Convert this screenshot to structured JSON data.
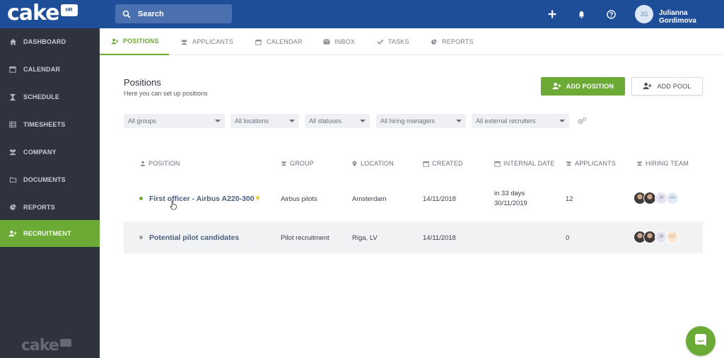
{
  "brand": {
    "logo_text": "cake",
    "logo_badge": "HR"
  },
  "colors": {
    "topbar": "#1f4e99",
    "sidebar": "#2e333d",
    "accent_green": "#6aaa35",
    "link_blue": "#4b5f80"
  },
  "search": {
    "placeholder": "Search"
  },
  "user": {
    "initials": "JG",
    "name": "Julianna Gordimova"
  },
  "topbar_icons": [
    "plus-icon",
    "bell-icon",
    "help-icon"
  ],
  "sidebar": {
    "items": [
      {
        "label": "DASHBOARD",
        "icon": "home-icon"
      },
      {
        "label": "CALENDAR",
        "icon": "calendar-icon"
      },
      {
        "label": "SCHEDULE",
        "icon": "hourglass-icon"
      },
      {
        "label": "TIMESHEETS",
        "icon": "table-icon"
      },
      {
        "label": "COMPANY",
        "icon": "users-icon"
      },
      {
        "label": "DOCUMENTS",
        "icon": "folder-icon"
      },
      {
        "label": "REPORTS",
        "icon": "pie-chart-icon"
      },
      {
        "label": "RECRUITMENT",
        "icon": "user-plus-icon",
        "active": true
      }
    ]
  },
  "tabs": [
    {
      "label": "POSITIONS",
      "icon": "user-plus-icon",
      "active": true
    },
    {
      "label": "APPLICANTS",
      "icon": "users-icon"
    },
    {
      "label": "CALENDAR",
      "icon": "calendar-icon"
    },
    {
      "label": "INBOX",
      "icon": "envelope-icon"
    },
    {
      "label": "TASKS",
      "icon": "check-icon"
    },
    {
      "label": "REPORTS",
      "icon": "pie-chart-icon"
    }
  ],
  "page": {
    "title": "Positions",
    "subtitle": "Here you can set up positions",
    "add_position_label": "ADD POSITION",
    "add_pool_label": "ADD POOL"
  },
  "filters": [
    {
      "label": "All groups"
    },
    {
      "label": "All locations"
    },
    {
      "label": "All statuses"
    },
    {
      "label": "All hiring managers"
    },
    {
      "label": "All external recruiters"
    }
  ],
  "table": {
    "columns": [
      {
        "label": "POSITION",
        "icon": "user-icon"
      },
      {
        "label": "GROUP",
        "icon": "users-icon"
      },
      {
        "label": "LOCATION",
        "icon": "map-pin-icon"
      },
      {
        "label": "CREATED",
        "icon": "calendar-icon"
      },
      {
        "label": "INTERNAL DATE",
        "icon": "calendar-icon"
      },
      {
        "label": "APPLICANTS",
        "icon": "users-icon"
      },
      {
        "label": "HIRING TEAM",
        "icon": "users-icon"
      }
    ],
    "rows": [
      {
        "status_color": "#6aaa35",
        "position": "First officer - Airbus A220-300",
        "starred": true,
        "group": "Airbus pilots",
        "location": "Amsterdam",
        "created": "14/11/2018",
        "internal_date_relative": "in 33 days",
        "internal_date": "30/11/2019",
        "applicants": "12",
        "team_initials": [
          "JB",
          "AH"
        ]
      },
      {
        "status_color": "#9aa0a8",
        "position": "Potential pilot candidates",
        "starred": false,
        "group": "Pilot recruitment",
        "location": "Riga, LV",
        "created": "14/11/2018",
        "internal_date_relative": "",
        "internal_date": "",
        "applicants": "0",
        "team_initials": [
          "JB",
          "EP"
        ]
      }
    ]
  }
}
